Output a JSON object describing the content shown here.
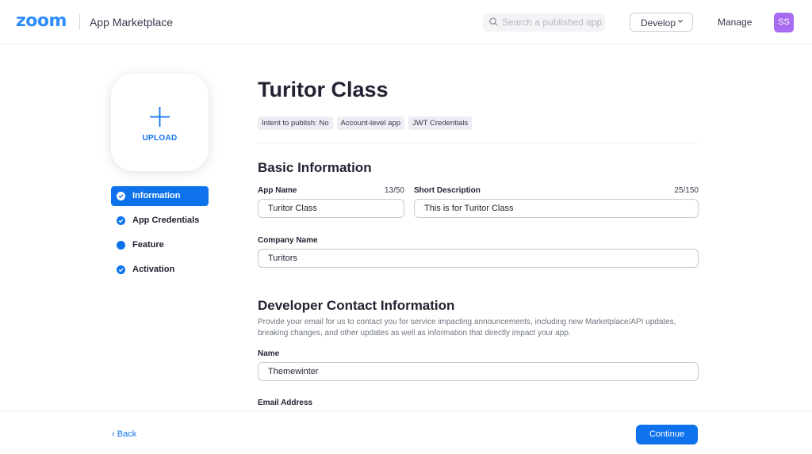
{
  "header": {
    "logo": "zoom",
    "app_title": "App Marketplace",
    "search_placeholder": "Search a published app",
    "develop_label": "Develop",
    "manage_label": "Manage",
    "avatar_initials": "SS"
  },
  "upload": {
    "label": "UPLOAD"
  },
  "steps": [
    {
      "label": "Information",
      "icon": "check-circle-icon",
      "active": true
    },
    {
      "label": "App Credentials",
      "icon": "check-circle-icon",
      "active": false
    },
    {
      "label": "Feature",
      "icon": "dot-circle-icon",
      "active": false
    },
    {
      "label": "Activation",
      "icon": "check-circle-icon",
      "active": false
    }
  ],
  "app": {
    "title": "Turitor Class",
    "tags": [
      "Intent to publish: No",
      "Account-level app",
      "JWT Credentials"
    ]
  },
  "basic_info": {
    "title": "Basic Information",
    "app_name_label": "App Name",
    "app_name_count": "13/50",
    "app_name_value": "Turitor Class",
    "short_desc_label": "Short Description",
    "short_desc_count": "25/150",
    "short_desc_value": "This is for Turitor Class",
    "company_label": "Company Name",
    "company_value": "Turitors"
  },
  "dev_contact": {
    "title": "Developer Contact Information",
    "description": "Provide your email for us to contact you for service impacting announcements, including new Marketplace/API updates, breaking changes, and other updates as well as information that directly impact your app.",
    "name_label": "Name",
    "name_value": "Themewinter",
    "email_label": "Email Address"
  },
  "footer": {
    "back_label": "Back",
    "continue_label": "Continue"
  },
  "colors": {
    "accent": "#0e72ed",
    "logo": "#2d8cff",
    "avatar": "#a86cf0"
  }
}
